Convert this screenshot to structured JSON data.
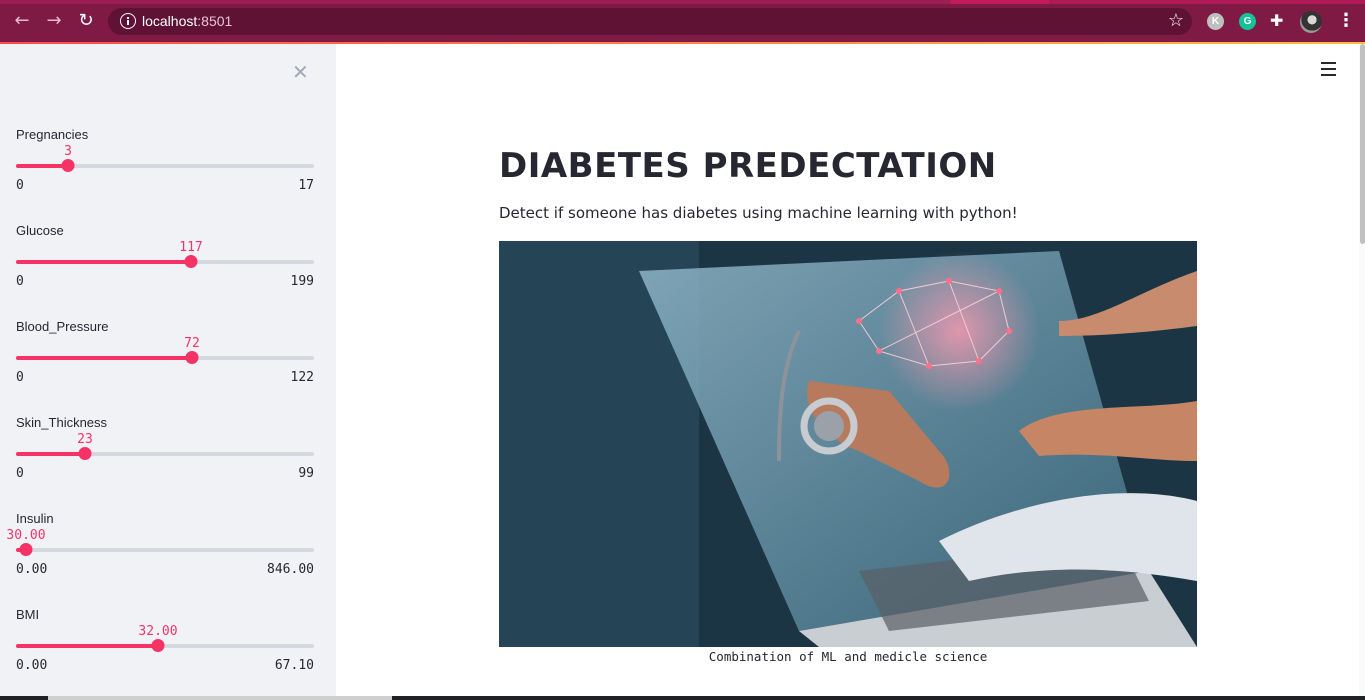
{
  "browser": {
    "url_host": "localhost",
    "url_port": ":8501",
    "extensions": [
      {
        "name": "extension-k",
        "letter": "K"
      },
      {
        "name": "grammarly",
        "letter": "G"
      }
    ]
  },
  "sidebar": {
    "sliders": [
      {
        "label": "Pregnancies",
        "value": "3",
        "min": "0",
        "max": "17",
        "fraction": 0.176
      },
      {
        "label": "Glucose",
        "value": "117",
        "min": "0",
        "max": "199",
        "fraction": 0.588
      },
      {
        "label": "Blood_Pressure",
        "value": "72",
        "min": "0",
        "max": "122",
        "fraction": 0.59
      },
      {
        "label": "Skin_Thickness",
        "value": "23",
        "min": "0",
        "max": "99",
        "fraction": 0.232
      },
      {
        "label": "Insulin",
        "value": "30.00",
        "min": "0.00",
        "max": "846.00",
        "fraction": 0.035
      },
      {
        "label": "BMI",
        "value": "32.00",
        "min": "0.00",
        "max": "67.10",
        "fraction": 0.477
      }
    ]
  },
  "main": {
    "title": "DIABETES PREDECTATION",
    "subtitle": "Detect if someone has diabetes using machine learning with python!",
    "image_caption": "Combination of ML and medicle science"
  },
  "colors": {
    "primary": "#f63366",
    "chrome": "#7f1a45",
    "sidebar_bg": "#f0f2f6"
  }
}
